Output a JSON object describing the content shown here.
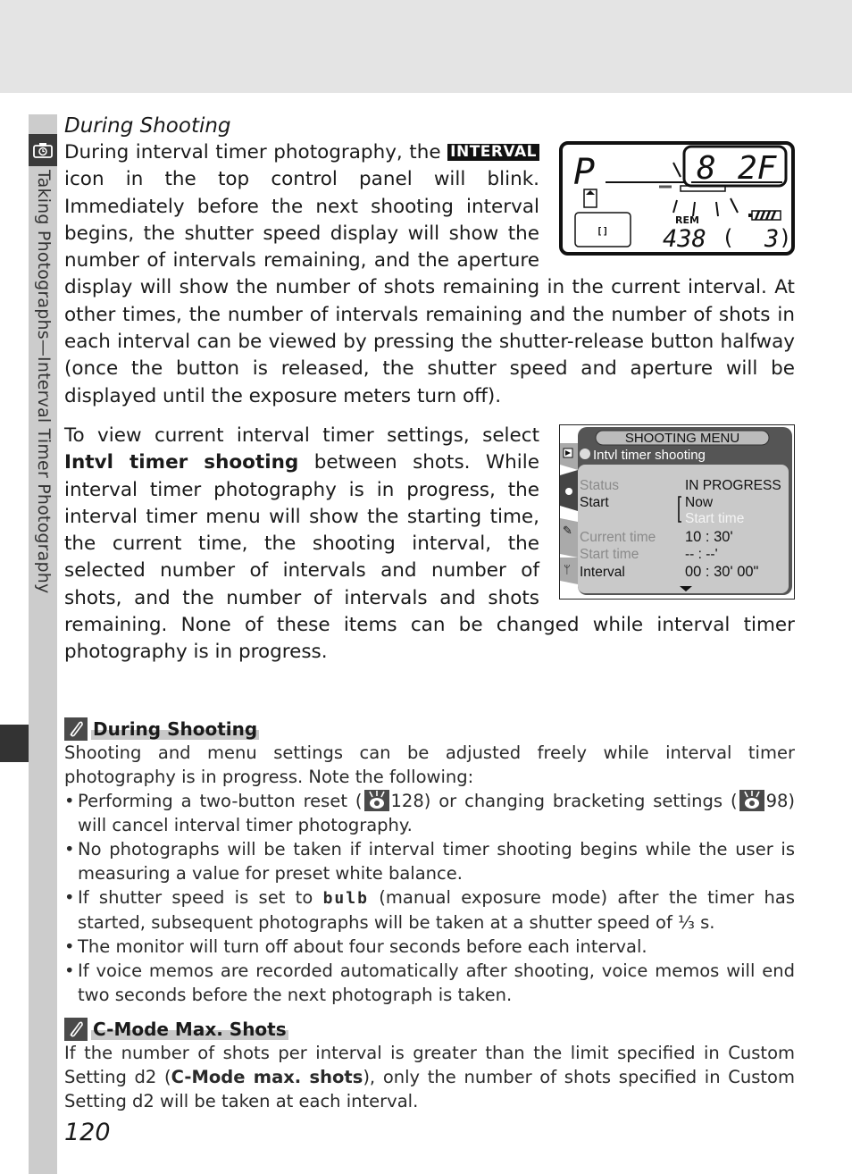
{
  "side_tab": {
    "title": "Taking Photographs—Interval Timer Photography",
    "icon": "camera-timer-icon"
  },
  "section": {
    "heading": "During Shooting",
    "para1_before_badge": "During interval timer photography, the",
    "interval_badge": "INTERVAL",
    "para1_after_badge": "icon in the top control panel will blink.  Immediately before the next shooting interval begins, the shutter speed display will show the number of intervals remaining, and the aperture display will show the number of shots remaining in the current interval.  At other times, the number of intervals remaining and the number of shots in each interval can be viewed by pressing the shutter-release button halfway (once the button is released, the shutter speed and aperture will be displayed until the exposure meters turn off).",
    "para2_before": "To view current interval timer settings, select",
    "para2_bold": "Intvl timer shooting",
    "para2_after": "between shots.  While interval timer photography is in progress, the interval timer menu will show the starting time, the current time, the shooting interval, the selected number of intervals and number of shots, and the number of intervals and shots remaining.  None of these items can be changed while interval timer photography is in progress."
  },
  "control_panel": {
    "mode": "P",
    "shutter_display": "8",
    "aperture_display": "2F",
    "rem_label": "REM",
    "frames_remaining": "438",
    "buffer": "3"
  },
  "menu_screen": {
    "title": "SHOOTING MENU",
    "subtitle": "Intvl timer shooting",
    "rows": [
      {
        "label": "Status",
        "value": "IN PROGRESS",
        "dim": true
      },
      {
        "label": "Start",
        "value": "Now",
        "dim": false
      },
      {
        "label": "",
        "value": "Start time",
        "dim": true
      },
      {
        "label": "Current time",
        "value": "10 : 30'",
        "dim": true
      },
      {
        "label": "Start time",
        "value": "-- : --'",
        "dim": true
      },
      {
        "label": "Interval",
        "value": "00 : 30' 00\"",
        "dim": false
      }
    ]
  },
  "notes": [
    {
      "title": "During Shooting",
      "intro": "Shooting and menu settings can be adjusted freely while interval timer photography is in progress.  Note the following:",
      "bullets": {
        "b1_a": "Performing a two-button reset (",
        "b1_ref1": "128",
        "b1_b": ") or changing bracketing settings (",
        "b1_ref2": "98",
        "b1_c": ") will cancel interval timer photography.",
        "b2": "No photographs will be taken if interval timer shooting begins while the user is measuring a value for preset white balance.",
        "b3_a": "If shutter speed is set to",
        "b3_bulb": "bulb",
        "b3_b": "(manual exposure mode) after the timer has started, subsequent photographs will be taken at a shutter speed of ⅓ s.",
        "b4": "The monitor will turn off about four seconds before each interval.",
        "b5": "If voice memos are recorded automatically after shooting, voice memos will end two seconds before the next photograph is taken."
      }
    },
    {
      "title": "C-Mode Max. Shots",
      "body_a": "If the number of shots per interval is greater than the limit specified in Custom Setting d2 (",
      "body_bold": "C-Mode max. shots",
      "body_b": "), only the number of shots specified in Custom Setting d2 will be taken at each interval."
    }
  ],
  "page_number": "120"
}
